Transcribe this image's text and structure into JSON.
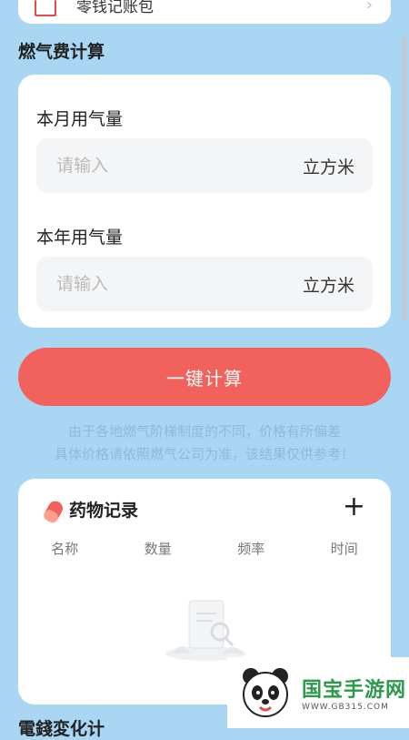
{
  "top_card": {
    "label": "零钱记账包"
  },
  "gas": {
    "section_title": "燃气费计算",
    "month_label": "本月用气量",
    "month_placeholder": "请输入",
    "month_unit": "立方米",
    "year_label": "本年用气量",
    "year_placeholder": "请输入",
    "year_unit": "立方米",
    "calc_button": "一键计算",
    "notice_line1": "由于各地燃气阶梯制度的不同，价格有所偏差",
    "notice_line2": "具体价格请依照燃气公司为准，该结果仅供参考！"
  },
  "medicine": {
    "title": "药物记录",
    "add_label": "+",
    "columns": [
      "名称",
      "数量",
      "频率",
      "时间"
    ]
  },
  "next_section": {
    "title": "電錢変化计"
  },
  "watermark": {
    "name": "国宝手游网",
    "url": "WWW.GB315.COM"
  },
  "colors": {
    "background": "#a9d7f3",
    "accent": "#f2625d",
    "notice": "#8fb9d6"
  }
}
